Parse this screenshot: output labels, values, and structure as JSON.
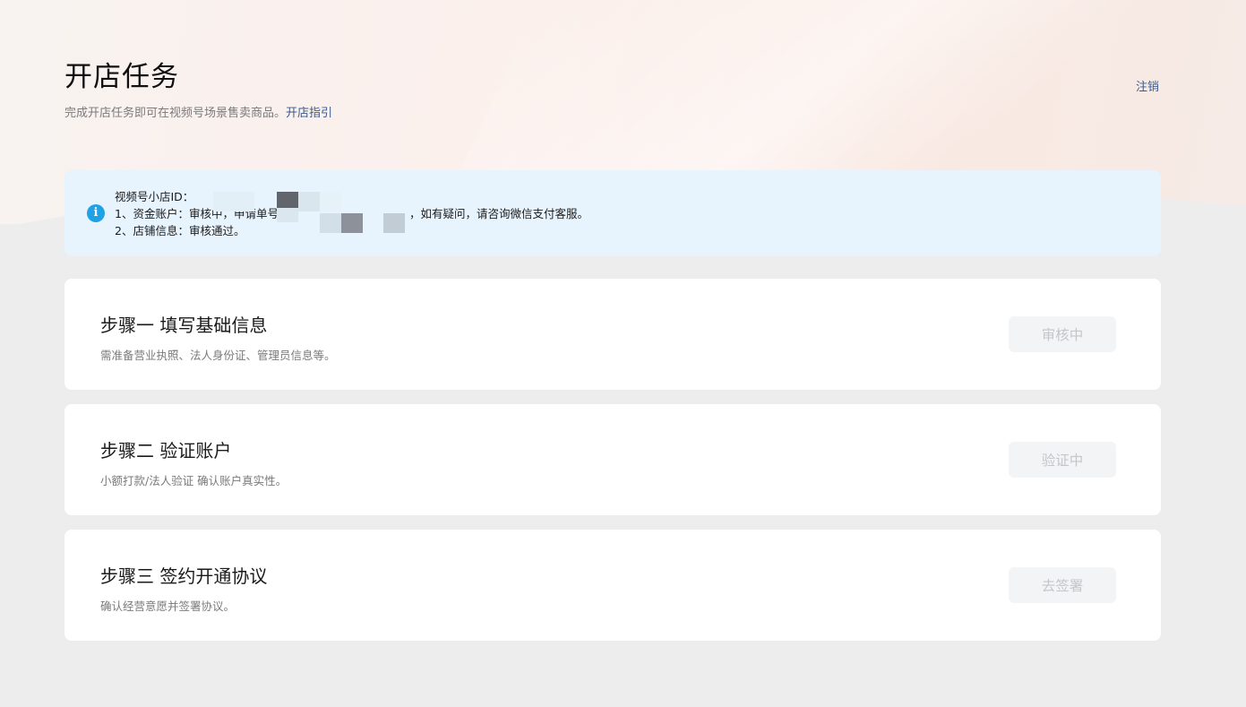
{
  "header": {
    "title": "开店任务",
    "subtitle_text": "完成开店任务即可在视频号场景售卖商品。",
    "guide_link": "开店指引",
    "logout": "注销"
  },
  "notice": {
    "icon": "info-icon",
    "shop_id_label": "视频号小店ID：",
    "line1_prefix": "1、资金账户：审核中，申请单号",
    "line1_suffix": "，如有疑问，请咨询微信支付客服。",
    "line2": "2、店铺信息：审核通过。"
  },
  "steps": [
    {
      "title": "步骤一 填写基础信息",
      "desc": "需准备营业执照、法人身份证、管理员信息等。",
      "button": "审核中"
    },
    {
      "title": "步骤二 验证账户",
      "desc": "小额打款/法人验证 确认账户真实性。",
      "button": "验证中"
    },
    {
      "title": "步骤三 签约开通协议",
      "desc": "确认经营意愿并签署协议。",
      "button": "去签署"
    }
  ],
  "colors": {
    "accent_link": "#3b5a8c",
    "info_icon": "#1fa1e6",
    "notice_bg": "#e8f4fd",
    "page_bg": "#ededed"
  }
}
